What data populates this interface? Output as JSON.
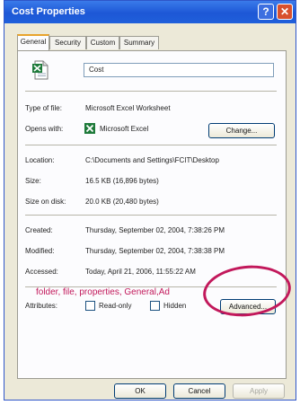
{
  "window": {
    "title": "Cost Properties"
  },
  "tabs": [
    "General",
    "Security",
    "Custom",
    "Summary"
  ],
  "file": {
    "name": "Cost"
  },
  "fields": {
    "type_label": "Type of file:",
    "type_value": "Microsoft Excel Worksheet",
    "opens_label": "Opens with:",
    "opens_value": "Microsoft Excel",
    "change_label": "Change...",
    "location_label": "Location:",
    "location_value": "C:\\Documents and Settings\\FCIT\\Desktop",
    "size_label": "Size:",
    "size_value": "16.5 KB (16,896 bytes)",
    "sizeondisk_label": "Size on disk:",
    "sizeondisk_value": "20.0 KB (20,480 bytes)",
    "created_label": "Created:",
    "created_value": "Thursday, September 02, 2004, 7:38:26 PM",
    "modified_label": "Modified:",
    "modified_value": "Thursday, September 02, 2004, 7:38:38 PM",
    "accessed_label": "Accessed:",
    "accessed_value": "Today, April 21, 2006, 11:55:22 AM"
  },
  "attributes": {
    "label": "Attributes:",
    "readonly": "Read-only",
    "hidden": "Hidden",
    "advanced": "Advanced..."
  },
  "annotation": "folder, file, properties, General,Ad",
  "buttons": {
    "ok": "OK",
    "cancel": "Cancel",
    "apply": "Apply"
  },
  "colors": {
    "title_bar": "#1d57d6",
    "annotation": "#c2185b",
    "tab_highlight": "#e8a32c"
  }
}
